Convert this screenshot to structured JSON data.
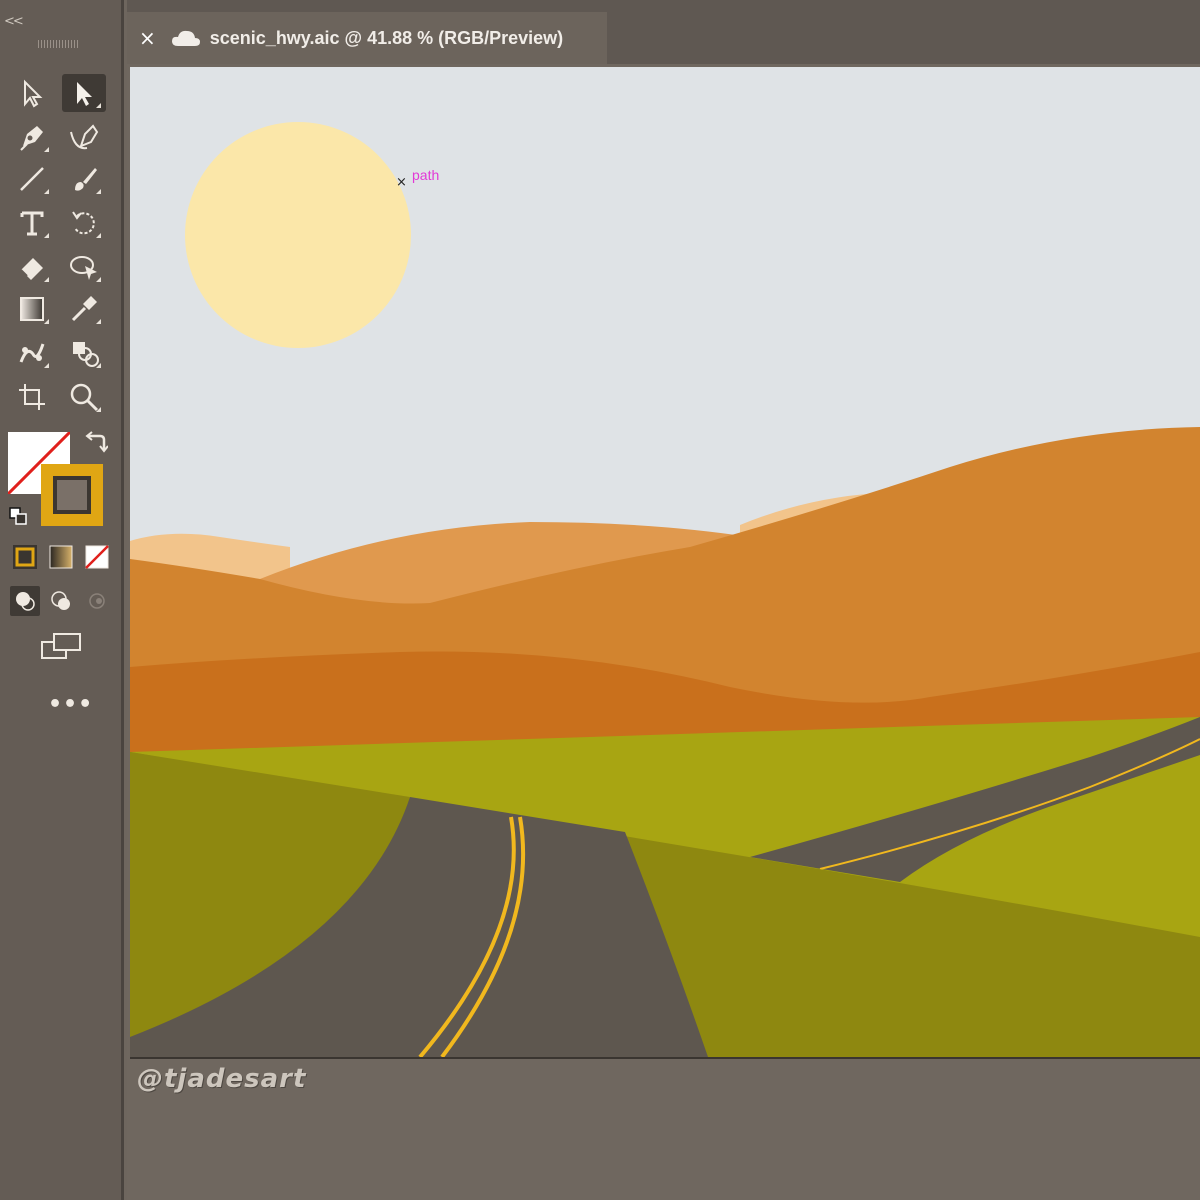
{
  "toolbar": {
    "collapse_glyph": "<<",
    "more_glyph": "•••",
    "tools": [
      {
        "name": "direct-selection-icon"
      },
      {
        "name": "selection-icon",
        "active": true
      },
      {
        "name": "pen-icon"
      },
      {
        "name": "curvature-icon"
      },
      {
        "name": "line-segment-icon"
      },
      {
        "name": "paintbrush-icon"
      },
      {
        "name": "type-icon"
      },
      {
        "name": "rotate-icon"
      },
      {
        "name": "eraser-icon"
      },
      {
        "name": "free-transform-icon"
      },
      {
        "name": "gradient-icon"
      },
      {
        "name": "eyedropper-icon"
      },
      {
        "name": "puppet-warp-icon"
      },
      {
        "name": "shape-builder-icon"
      },
      {
        "name": "artboard-icon"
      },
      {
        "name": "zoom-icon"
      }
    ],
    "fill_color": "none",
    "stroke_color": "#E0A614"
  },
  "document": {
    "close_glyph": "×",
    "title": "scenic_hwy.aic @ 41.88 % (RGB/Preview)"
  },
  "artboard": {
    "path_label": "path",
    "anchor_glyph": "×"
  },
  "watermark": "@tjadesart",
  "colors": {
    "sky": "#DFE3E6",
    "sun": "#FBE7A9",
    "dune_light": "#F2C48B",
    "dune_mid": "#E0994E",
    "dune_main": "#D2842F",
    "dune_dark": "#C9701C",
    "grass_light": "#A8A512",
    "grass_dark": "#8E8810",
    "road": "#5E574F",
    "road_line": "#F1B81E",
    "accent_selection": "#E23AD6"
  }
}
